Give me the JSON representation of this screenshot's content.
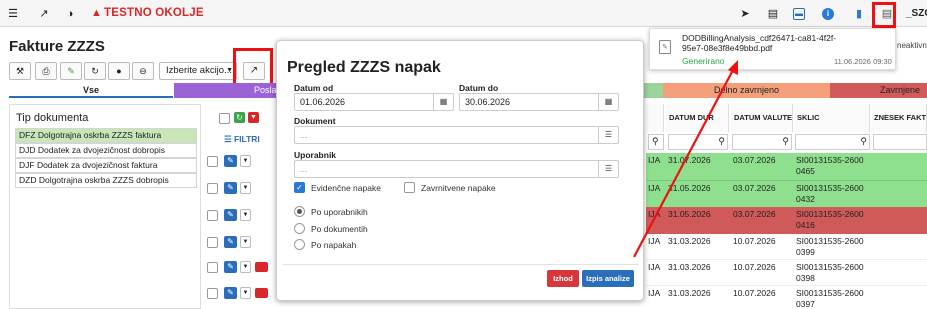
{
  "topbar": {
    "env_label": "TESTNO OKOLJE",
    "user_label": "_SZO",
    "left_icons": [
      "menu-icon",
      "external-link-icon",
      "contrast-icon"
    ],
    "right_icons": [
      "send-icon",
      "card-icon",
      "screen-icon",
      "info-icon",
      "book-icon",
      "document-icon"
    ]
  },
  "page": {
    "title": "Fakture ZZZS",
    "action_select": "Izberite akcijo..."
  },
  "tabs": [
    {
      "label": "Vse",
      "color": "#ffffff"
    },
    {
      "label": "Poslane",
      "color": "#9b63d6"
    },
    {
      "label": "",
      "color": "#9bd59b"
    },
    {
      "label": "Delno zavrnjeno",
      "color": "#f3a07a"
    },
    {
      "label": "Zavrnjene",
      "color": "#d35a5a"
    }
  ],
  "doc_panel": {
    "title": "Tip dokumenta",
    "items": [
      "DFZ Dolgotrajna oskrba ZZZS faktura",
      "DJD Dodatek za dvojezičnost dobropis",
      "DJF Dodatek za dvojezičnost faktura",
      "DZD Dolgotrajna oskrba ZZZS dobropis"
    ]
  },
  "filters_label": "FILTRI",
  "grid": {
    "hidden_label": "neaktivne",
    "columns": [
      "DATUM DUR",
      "DATUM VALUTE",
      "SKLIC",
      "ZNESEK FAKTURE"
    ],
    "rows": [
      {
        "prefix": "IJA",
        "datum_dur": "31.07.2026",
        "datum_valute": "03.07.2026",
        "sklic": "SI00131535-26000465",
        "color": "#8ee08e"
      },
      {
        "prefix": "IJA",
        "datum_dur": "31.05.2026",
        "datum_valute": "03.07.2026",
        "sklic": "SI00131535-26000432",
        "color": "#8ee08e"
      },
      {
        "prefix": "IJA",
        "datum_dur": "31.05.2026",
        "datum_valute": "03.07.2026",
        "sklic": "SI00131535-26000416",
        "color": "#d05a5a"
      },
      {
        "prefix": "IJA",
        "datum_dur": "31.03.2026",
        "datum_valute": "10.07.2026",
        "sklic": "SI00131535-26000399",
        "color": "#ffffff"
      },
      {
        "prefix": "IJA",
        "datum_dur": "31.03.2026",
        "datum_valute": "10.07.2026",
        "sklic": "SI00131535-26000398",
        "color": "#ffffff"
      },
      {
        "prefix": "IJA",
        "datum_dur": "31.03.2026",
        "datum_valute": "10.07.2026",
        "sklic": "SI00131535-26000397",
        "color": "#ffffff"
      }
    ]
  },
  "dialog": {
    "title": "Pregled ZZZS napak",
    "datum_od_label": "Datum od",
    "datum_od": "01.06.2026",
    "datum_do_label": "Datum do",
    "datum_do": "30.06.2026",
    "dokument_label": "Dokument",
    "dokument_placeholder": "...",
    "uporabnik_label": "Uporabnik",
    "uporabnik_placeholder": "...",
    "evidencne_label": "Evidenčne napake",
    "zavrnitvene_label": "Zavrnitvene napake",
    "radio_uporabnikih": "Po uporabnikih",
    "radio_dokumentih": "Po dokumentih",
    "radio_napakah": "Po napakah",
    "close_label": "Izhod",
    "print_label": "Izpis analize"
  },
  "notification": {
    "filename": "DODBillingAnalysis_cdf26471-ca81-4f2f-95e7-08e3f8e49bbd.pdf",
    "status": "Generirano",
    "time": "11.06.2026 09:30"
  }
}
